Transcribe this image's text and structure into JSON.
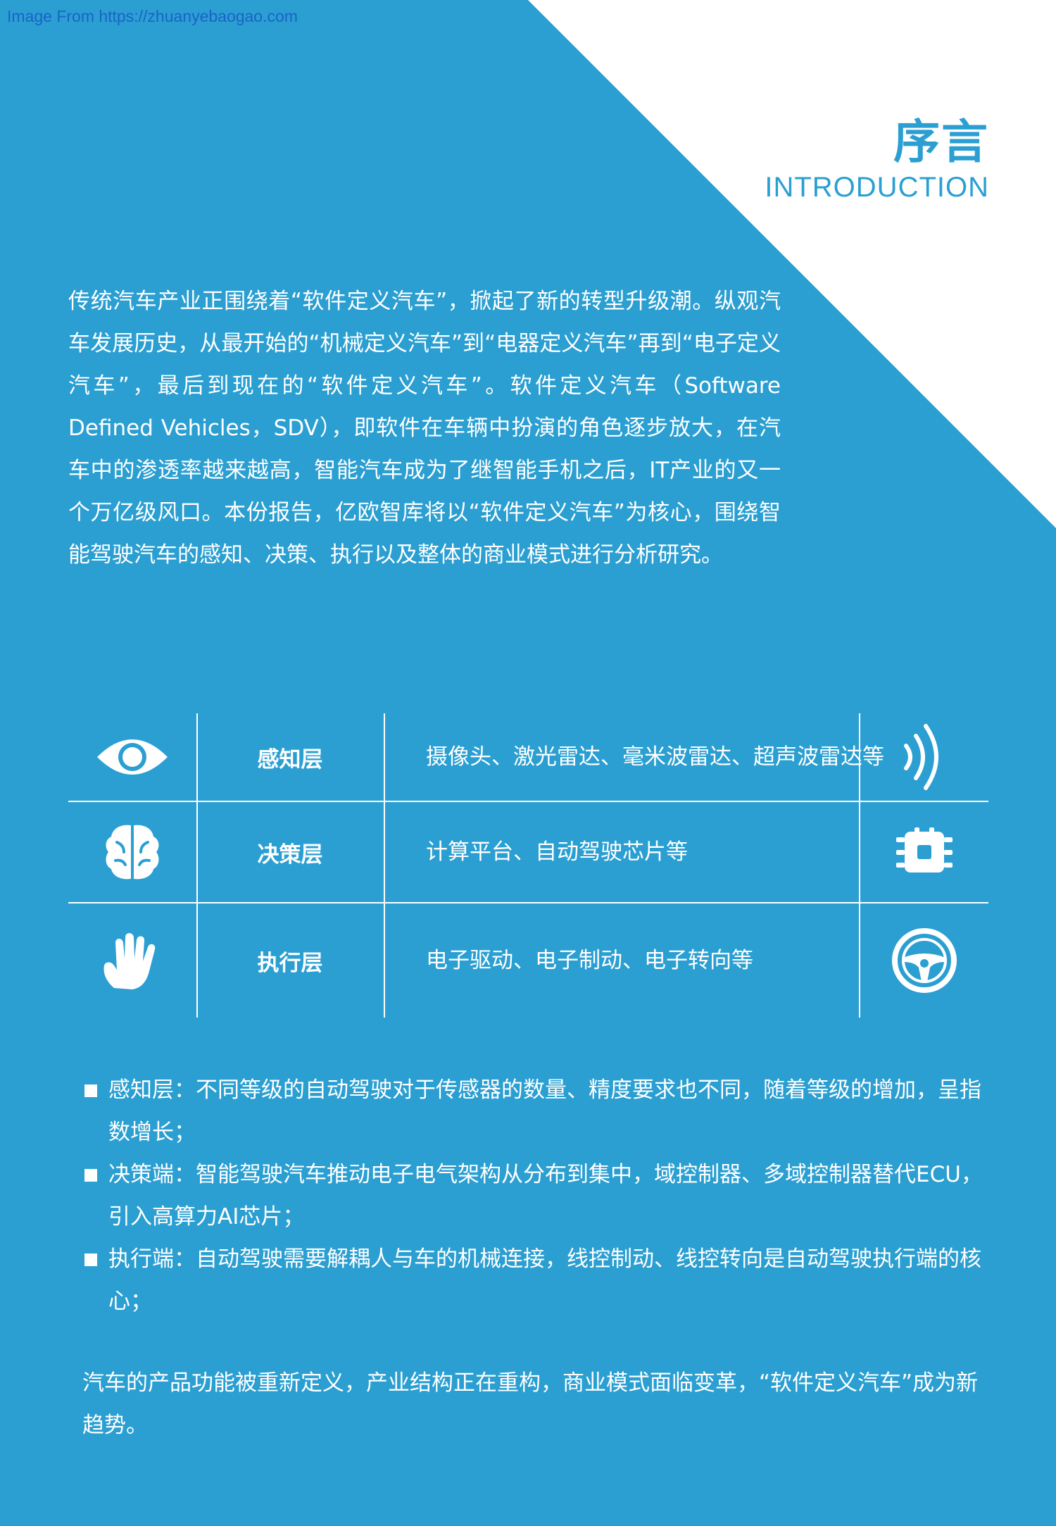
{
  "watermark": "Image From https://zhuanyebaogao.com",
  "header": {
    "title_cn": "序言",
    "title_en": "INTRODUCTION"
  },
  "intro_paragraph": "传统汽车产业正围绕着“软件定义汽车”，掀起了新的转型升级潮。纵观汽车发展历史，从最开始的“机械定义汽车”到“电器定义汽车”再到“电子定义汽车”，最后到现在的“软件定义汽车”。软件定义汽车（Software Defined Vehicles，SDV），即软件在车辆中扮演的角色逐步放大，在汽车中的渗透率越来越高，智能汽车成为了继智能手机之后，IT产业的又一个万亿级风口。本份报告，亿欧智库将以“软件定义汽车”为核心，围绕智能驾驶汽车的感知、决策、执行以及整体的商业模式进行分析研究。",
  "layers": [
    {
      "name": "感知层",
      "desc": "摄像头、激光雷达、毫米波雷达、超声波雷达等",
      "left_icon": "eye-icon",
      "right_icon": "signal-waves-icon"
    },
    {
      "name": "决策层",
      "desc": "计算平台、自动驾驶芯片等",
      "left_icon": "brain-icon",
      "right_icon": "chip-icon"
    },
    {
      "name": "执行层",
      "desc": "电子驱动、电子制动、电子转向等",
      "left_icon": "hand-icon",
      "right_icon": "steering-wheel-icon"
    }
  ],
  "bullets": [
    "感知层：不同等级的自动驾驶对于传感器的数量、精度要求也不同，随着等级的增加，呈指数增长；",
    "决策端：智能驾驶汽车推动电子电气架构从分布到集中，域控制器、多域控制器替代ECU，引入高算力AI芯片；",
    "执行端：自动驾驶需要解耦人与车的机械连接，线控制动、线控转向是自动驾驶执行端的核心；"
  ],
  "closing_paragraph": "汽车的产品功能被重新定义，产业结构正在重构，商业模式面临变革，“软件定义汽车”成为新趋势。",
  "colors": {
    "background": "#2b9fd2",
    "corner": "#ffffff",
    "text": "#ffffff",
    "watermark": "#1a63c9"
  }
}
